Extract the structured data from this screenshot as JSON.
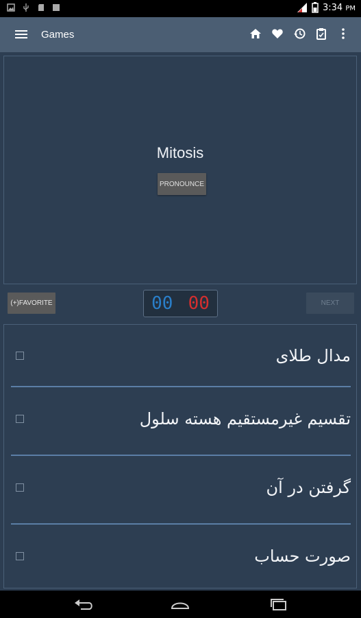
{
  "status_bar": {
    "time": "3:34",
    "ampm": "PM",
    "icons": [
      "image-icon",
      "usb-icon",
      "sdcard-icon",
      "photo-icon",
      "signal-icon",
      "battery-icon"
    ]
  },
  "toolbar": {
    "title": "Games",
    "icons": [
      "home-icon",
      "heart-icon",
      "history-icon",
      "clipboard-icon",
      "more-icon"
    ]
  },
  "card": {
    "word": "Mitosis",
    "pronounce_label": "PRONOUNCE"
  },
  "controls": {
    "favorite_label": "(+)FAVORITE",
    "score_correct": "00",
    "score_wrong": "00",
    "next_label": "NEXT"
  },
  "options": [
    {
      "text": "مدال طلای"
    },
    {
      "text": "تقسیم غیرمستقیم هسته سلول"
    },
    {
      "text": "گرفتن در آن"
    },
    {
      "text": "صورت حساب"
    }
  ],
  "colors": {
    "background": "#2d3e52",
    "toolbar": "#4b5e73",
    "correct": "#2a7fc9",
    "wrong": "#d32f2f",
    "divider": "#5b7ea6"
  }
}
